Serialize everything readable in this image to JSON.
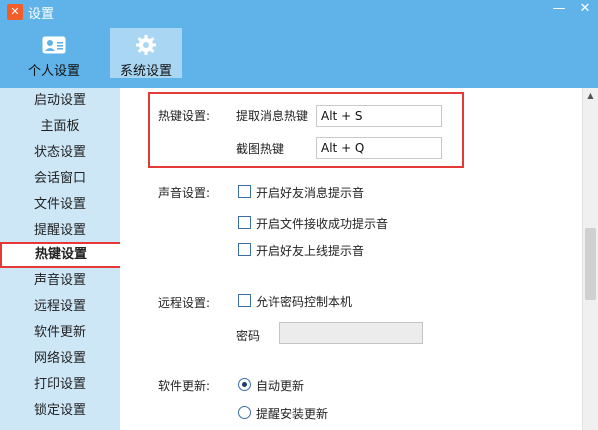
{
  "window": {
    "title": "设置",
    "minimize": "—",
    "close": "✕"
  },
  "tabs": [
    {
      "label": "个人设置",
      "icon": "user-card-icon",
      "active": false
    },
    {
      "label": "系统设置",
      "icon": "gear-icon",
      "active": true
    }
  ],
  "sidebar": {
    "items": [
      {
        "label": "启动设置"
      },
      {
        "label": "主面板"
      },
      {
        "label": "状态设置"
      },
      {
        "label": "会话窗口"
      },
      {
        "label": "文件设置"
      },
      {
        "label": "提醒设置"
      },
      {
        "label": "热键设置",
        "active": true
      },
      {
        "label": "声音设置"
      },
      {
        "label": "远程设置"
      },
      {
        "label": "软件更新"
      },
      {
        "label": "网络设置"
      },
      {
        "label": "打印设置"
      },
      {
        "label": "锁定设置"
      }
    ]
  },
  "hotkeys": {
    "section_label": "热键设置:",
    "extract_label": "提取消息热键",
    "extract_value": "Alt + S",
    "screenshot_label": "截图热键",
    "screenshot_value": "Alt + Q"
  },
  "sound": {
    "section_label": "声音设置:",
    "options": [
      {
        "label": "开启好友消息提示音",
        "checked": false
      },
      {
        "label": "开启文件接收成功提示音",
        "checked": false
      },
      {
        "label": "开启好友上线提示音",
        "checked": false
      }
    ]
  },
  "remote": {
    "section_label": "远程设置:",
    "allow_label": "允许密码控制本机",
    "allow_checked": false,
    "password_label": "密码",
    "password_value": ""
  },
  "update": {
    "section_label": "软件更新:",
    "options": [
      {
        "label": "自动更新",
        "selected": true
      },
      {
        "label": "提醒安装更新",
        "selected": false
      }
    ]
  },
  "colors": {
    "titlebar": "#5fb3e8",
    "sidebar": "#cde7f7",
    "highlight": "#e53935"
  }
}
